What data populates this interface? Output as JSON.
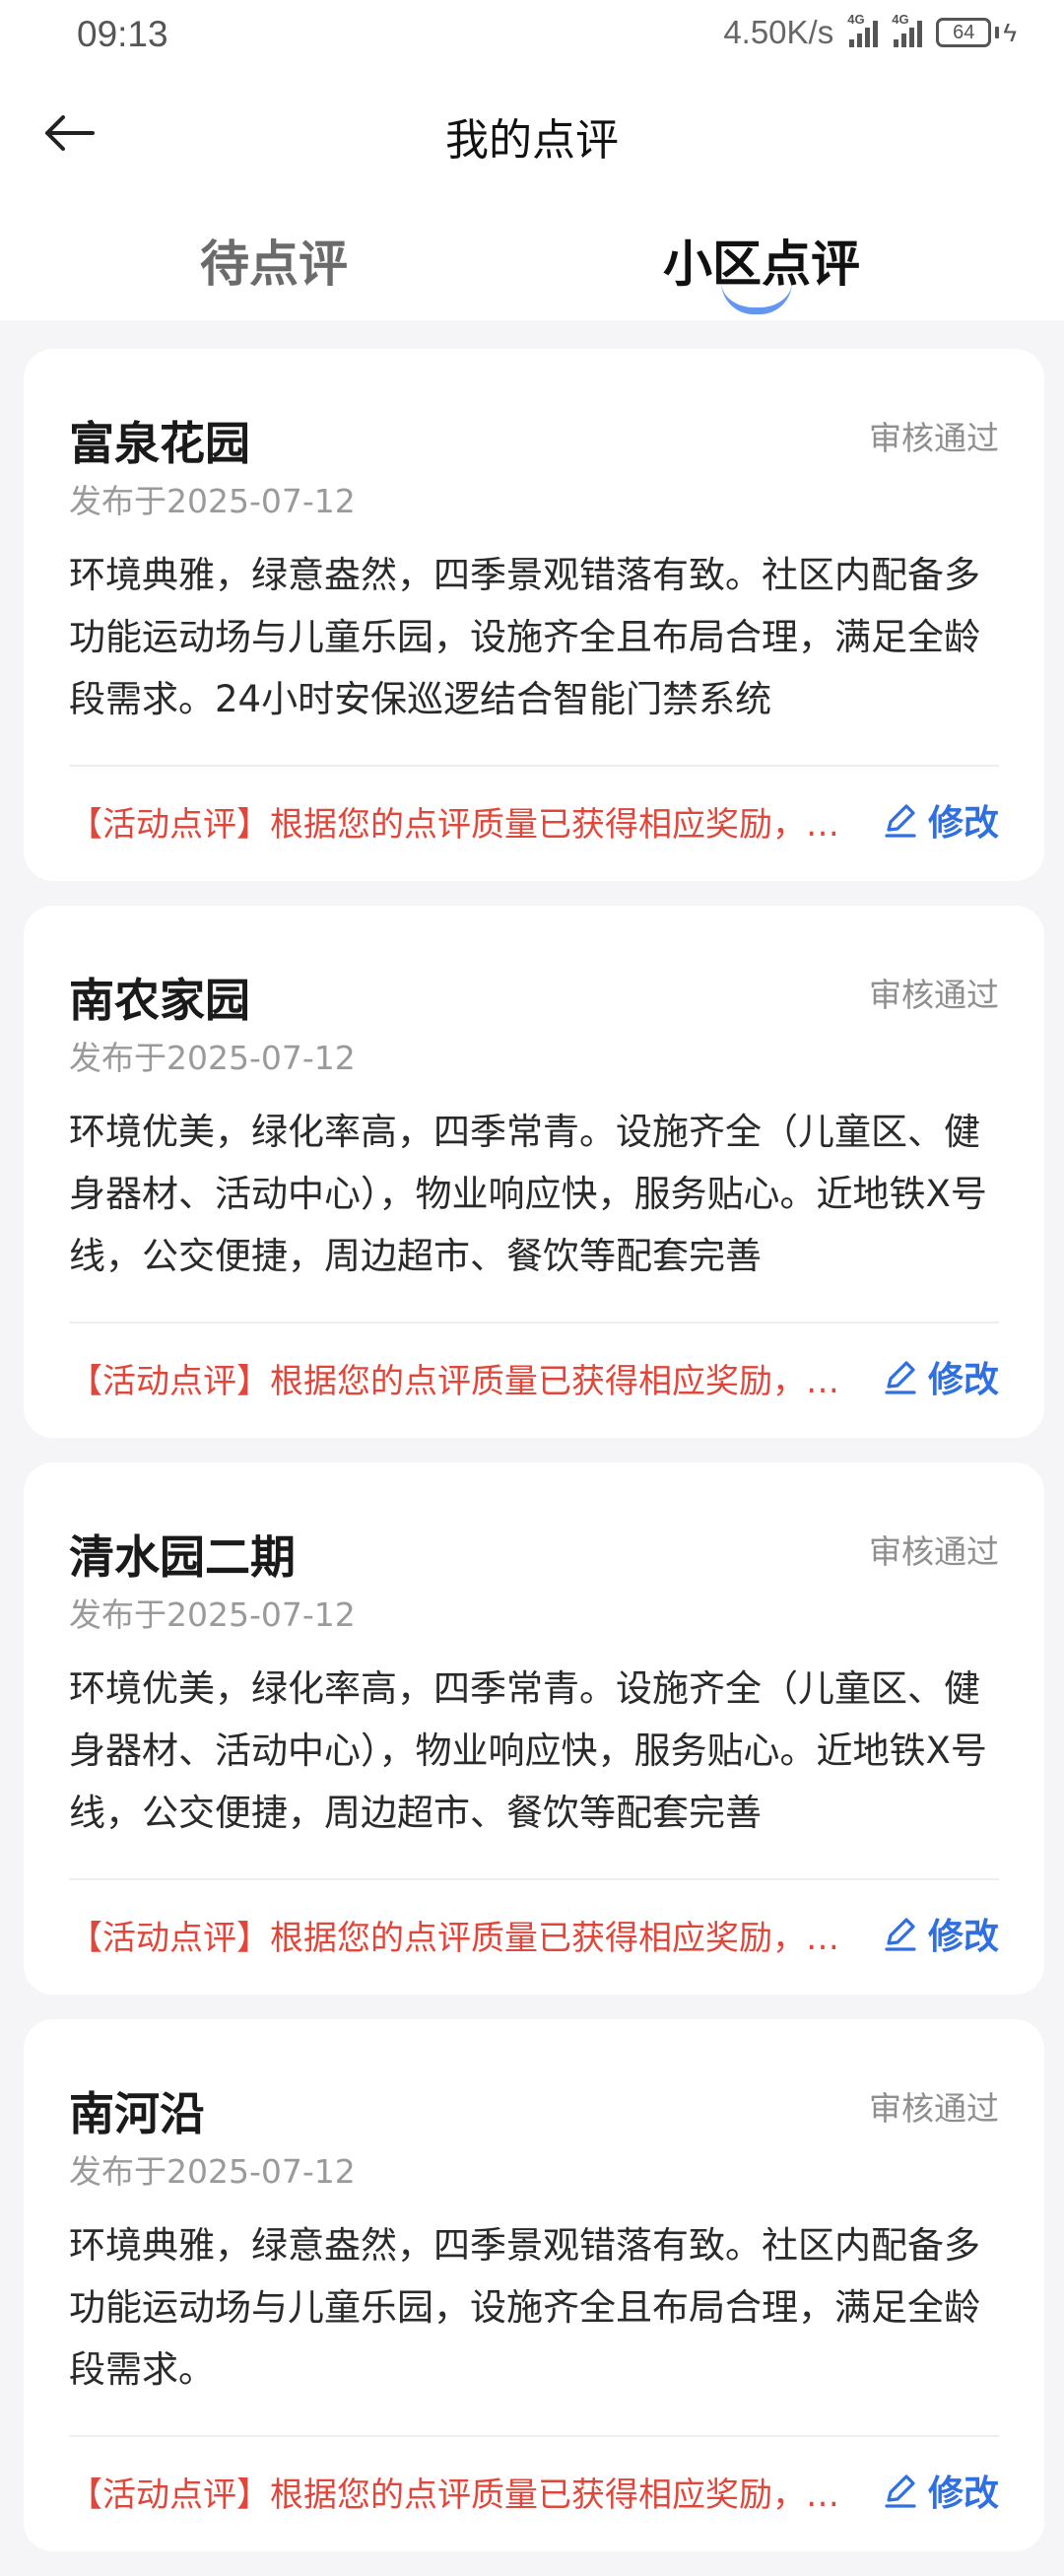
{
  "status_bar": {
    "time": "09:13",
    "net_speed": "4.50K/s",
    "network_1": "4G",
    "network_2": "4G",
    "battery": "64"
  },
  "header": {
    "title": "我的点评",
    "tabs": [
      {
        "label": "待点评",
        "active": false
      },
      {
        "label": "小区点评",
        "active": true
      }
    ]
  },
  "reviews": [
    {
      "name": "富泉花园",
      "status": "审核通过",
      "date": "发布于2025-07-12",
      "content": "环境典雅，绿意盎然，四季景观错落有致。社区内配备多功能运动场与儿童乐园，设施齐全且布局合理，满足全龄段需求。24小时安保巡逻结合智能门禁系统",
      "activity": "【活动点评】根据您的点评质量已获得相应奖励，请查收",
      "edit_label": "修改"
    },
    {
      "name": "南农家园",
      "status": "审核通过",
      "date": "发布于2025-07-12",
      "content": "环境优美，绿化率高，四季常青。设施齐全（儿童区、健身器材、活动中心），物业响应快，服务贴心。近地铁X号线，公交便捷，周边超市、餐饮等配套完善",
      "activity": "【活动点评】根据您的点评质量已获得相应奖励，请查收",
      "edit_label": "修改"
    },
    {
      "name": "清水园二期",
      "status": "审核通过",
      "date": "发布于2025-07-12",
      "content": "环境优美，绿化率高，四季常青。设施齐全（儿童区、健身器材、活动中心），物业响应快，服务贴心。近地铁X号线，公交便捷，周边超市、餐饮等配套完善",
      "activity": "【活动点评】根据您的点评质量已获得相应奖励，请查收",
      "edit_label": "修改"
    },
    {
      "name": "南河沿",
      "status": "审核通过",
      "date": "发布于2025-07-12",
      "content": "环境典雅，绿意盎然，四季景观错落有致。社区内配备多功能运动场与儿童乐园，设施齐全且布局合理，满足全龄段需求。",
      "activity": "【活动点评】根据您的点评质量已获得相应奖励，请查收",
      "edit_label": "修改"
    }
  ],
  "colors": {
    "accent": "#2f6fe0",
    "activity": "#e0473a",
    "background": "#f5f5f7"
  }
}
